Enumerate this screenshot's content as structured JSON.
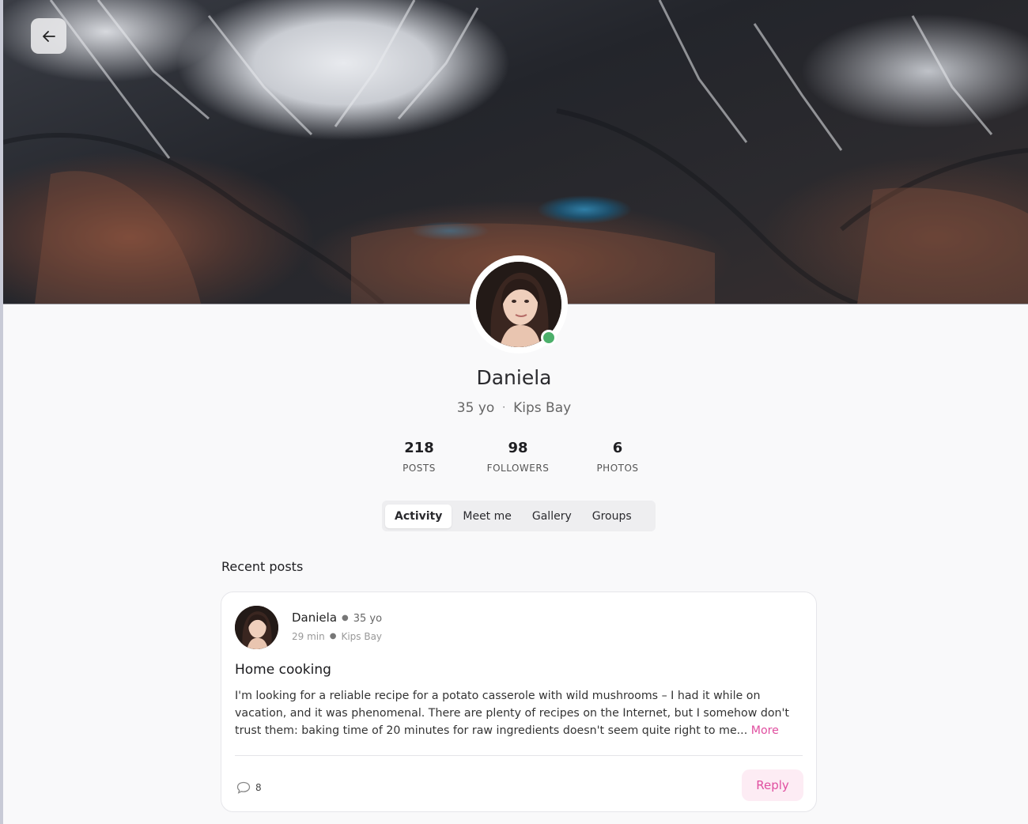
{
  "profile": {
    "name": "Daniela",
    "age": "35 yo",
    "separator": "·",
    "location": "Kips Bay",
    "online_color": "#4caf6a"
  },
  "stats": [
    {
      "value": "218",
      "label": "POSTS"
    },
    {
      "value": "98",
      "label": "FOLLOWERS"
    },
    {
      "value": "6",
      "label": "PHOTOS"
    }
  ],
  "tabs": [
    {
      "label": "Activity",
      "active": true
    },
    {
      "label": "Meet me",
      "active": false
    },
    {
      "label": "Gallery",
      "active": false
    },
    {
      "label": "Groups",
      "active": false
    }
  ],
  "feed": {
    "section_title": "Recent posts",
    "post": {
      "author": "Daniela",
      "author_age": "35 yo",
      "time": "29 min",
      "location": "Kips Bay",
      "title": "Home cooking",
      "body": "I'm looking for a reliable recipe for a potato casserole with wild mushrooms – I had it while on vacation, and it was phenomenal. There are plenty of recipes on the Internet, but I somehow don't trust them: baking time of 20 minutes for raw ingredients doesn't seem quite right to me...",
      "more_label": "More",
      "comment_count": "8",
      "reply_label": "Reply"
    }
  },
  "colors": {
    "accent": "#e04fa0",
    "accent_bg": "#fdecf4"
  },
  "icons": {
    "back": "arrow-left-icon",
    "comments": "speech-bubble-icon"
  }
}
